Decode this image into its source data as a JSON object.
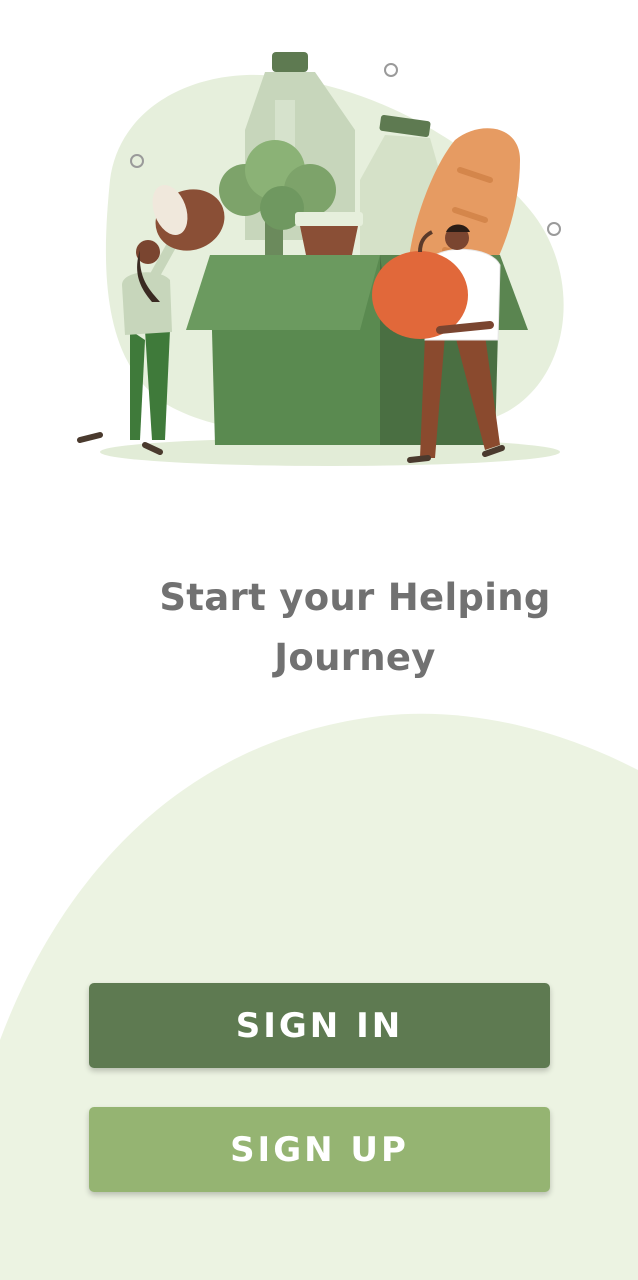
{
  "headline": {
    "line1": "Start your Helping",
    "line2": "Journey"
  },
  "buttons": {
    "sign_in": "SIGN IN",
    "sign_up": "SIGN UP"
  },
  "colors": {
    "sign_in_bg": "#5e7a51",
    "sign_up_bg": "#95b472",
    "headline_text": "#717171",
    "background_blob": "#ecf3e2",
    "button_text": "#ffffff"
  },
  "illustration": {
    "subject": "donation-box-with-groceries"
  }
}
